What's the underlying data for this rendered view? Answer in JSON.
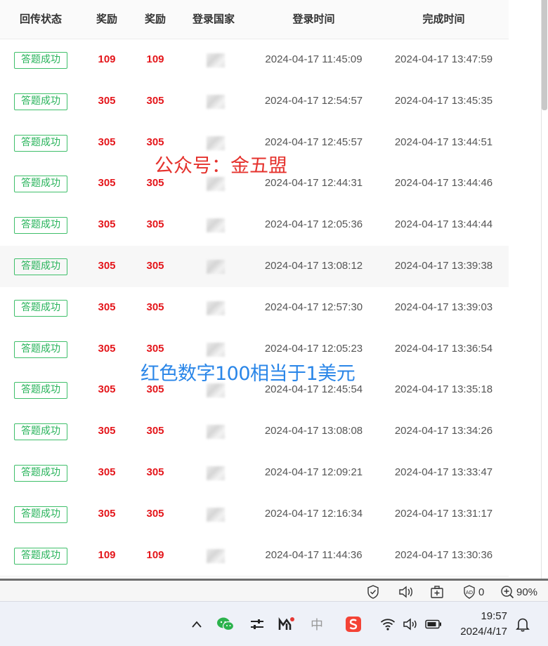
{
  "table": {
    "headers": [
      "回传状态",
      "奖励",
      "奖励",
      "登录国家",
      "登录时间",
      "完成时间"
    ],
    "rows": [
      {
        "status": "答题成功",
        "reward1": "109",
        "reward2": "109",
        "login": "2024-04-17 11:45:09",
        "done": "2024-04-17 13:47:59"
      },
      {
        "status": "答题成功",
        "reward1": "305",
        "reward2": "305",
        "login": "2024-04-17 12:54:57",
        "done": "2024-04-17 13:45:35"
      },
      {
        "status": "答题成功",
        "reward1": "305",
        "reward2": "305",
        "login": "2024-04-17 12:45:57",
        "done": "2024-04-17 13:44:51"
      },
      {
        "status": "答题成功",
        "reward1": "305",
        "reward2": "305",
        "login": "2024-04-17 12:44:31",
        "done": "2024-04-17 13:44:46"
      },
      {
        "status": "答题成功",
        "reward1": "305",
        "reward2": "305",
        "login": "2024-04-17 12:05:36",
        "done": "2024-04-17 13:44:44"
      },
      {
        "status": "答题成功",
        "reward1": "305",
        "reward2": "305",
        "login": "2024-04-17 13:08:12",
        "done": "2024-04-17 13:39:38"
      },
      {
        "status": "答题成功",
        "reward1": "305",
        "reward2": "305",
        "login": "2024-04-17 12:57:30",
        "done": "2024-04-17 13:39:03"
      },
      {
        "status": "答题成功",
        "reward1": "305",
        "reward2": "305",
        "login": "2024-04-17 12:05:23",
        "done": "2024-04-17 13:36:54"
      },
      {
        "status": "答题成功",
        "reward1": "305",
        "reward2": "305",
        "login": "2024-04-17 12:45:54",
        "done": "2024-04-17 13:35:18"
      },
      {
        "status": "答题成功",
        "reward1": "305",
        "reward2": "305",
        "login": "2024-04-17 13:08:08",
        "done": "2024-04-17 13:34:26"
      },
      {
        "status": "答题成功",
        "reward1": "305",
        "reward2": "305",
        "login": "2024-04-17 12:09:21",
        "done": "2024-04-17 13:33:47"
      },
      {
        "status": "答题成功",
        "reward1": "305",
        "reward2": "305",
        "login": "2024-04-17 12:16:34",
        "done": "2024-04-17 13:31:17"
      },
      {
        "status": "答题成功",
        "reward1": "109",
        "reward2": "109",
        "login": "2024-04-17 11:44:36",
        "done": "2024-04-17 13:30:36"
      }
    ]
  },
  "overlays": {
    "text1": "公众号：金五盟",
    "text2": "红色数字100相当于1美元"
  },
  "browser_status": {
    "ad_count": "0",
    "zoom": "90%"
  },
  "taskbar": {
    "time": "19:57",
    "date": "2024/4/17",
    "ime_label": "中"
  },
  "colors": {
    "reward": "#e4161b",
    "badge": "#27b35a",
    "overlay1": "#e5322d",
    "overlay2": "#2a86e8"
  }
}
